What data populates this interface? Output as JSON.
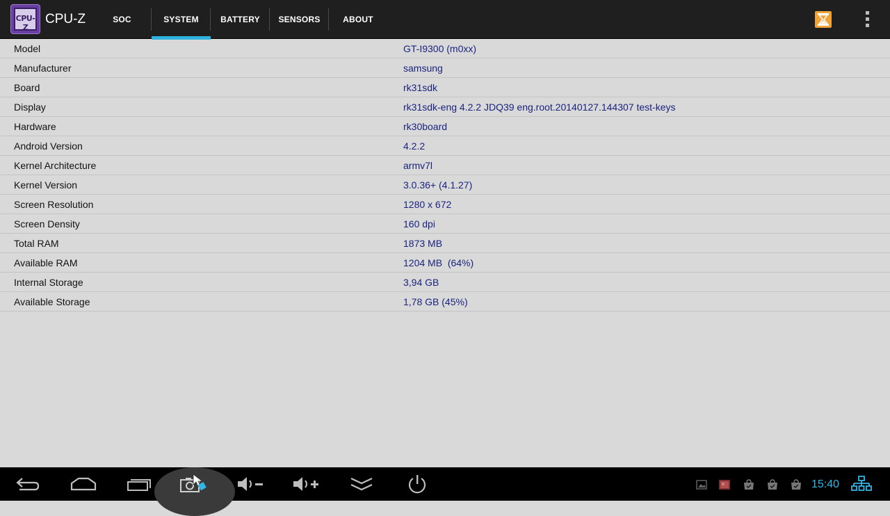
{
  "app": {
    "title": "CPU-Z",
    "icon_text": "CPU-Z",
    "icon": "cpu-z-chip-icon"
  },
  "tabs": [
    {
      "label": "SOC"
    },
    {
      "label": "SYSTEM",
      "active": true
    },
    {
      "label": "BATTERY"
    },
    {
      "label": "SENSORS"
    },
    {
      "label": "ABOUT"
    }
  ],
  "actions": {
    "hourglass_icon": "hourglass-icon",
    "overflow_icon": "overflow-menu-icon"
  },
  "rows": [
    {
      "label": "Model",
      "value": "GT-I9300 (m0xx)"
    },
    {
      "label": "Manufacturer",
      "value": "samsung"
    },
    {
      "label": "Board",
      "value": "rk31sdk"
    },
    {
      "label": "Display",
      "value": "rk31sdk-eng 4.2.2 JDQ39 eng.root.20140127.144307 test-keys"
    },
    {
      "label": "Hardware",
      "value": "rk30board"
    },
    {
      "label": "Android Version",
      "value": "4.2.2"
    },
    {
      "label": "Kernel Architecture",
      "value": "armv7l"
    },
    {
      "label": "Kernel Version",
      "value": "3.0.36+ (4.1.27)"
    },
    {
      "label": "Screen Resolution",
      "value": "1280 x 672"
    },
    {
      "label": "Screen Density",
      "value": "160 dpi"
    },
    {
      "label": "Total RAM",
      "value": "1873 MB"
    },
    {
      "label": "Available RAM",
      "value": "1204 MB  (64%)"
    },
    {
      "label": "Internal Storage",
      "value": "3,94 GB"
    },
    {
      "label": "Available Storage",
      "value": "1,78 GB (45%)"
    }
  ],
  "navbar": {
    "buttons": [
      "back-icon",
      "home-icon",
      "recent-apps-icon",
      "screenshot-icon",
      "volume-down-icon",
      "volume-up-icon",
      "collapse-icon",
      "power-icon"
    ],
    "status_icons": [
      "gallery-notification-icon",
      "photo-notification-icon",
      "store-notification-icon",
      "store-notification-icon",
      "store-notification-icon"
    ],
    "clock": "15:40",
    "network_icon": "ethernet-icon"
  },
  "colors": {
    "accent": "#33b5e5",
    "value_text": "#1a237e",
    "background": "#d9d9d9",
    "actionbar": "#1f1f1f"
  }
}
